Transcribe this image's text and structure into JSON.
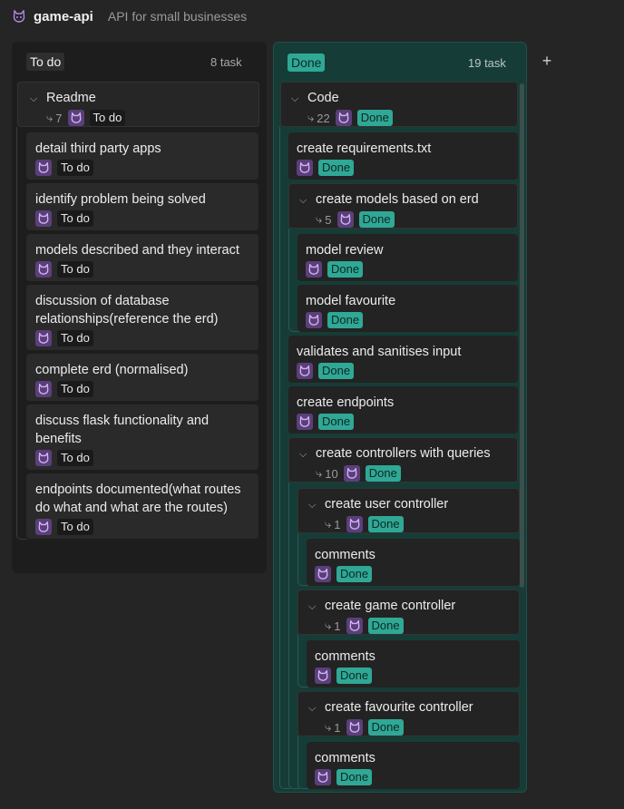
{
  "app": {
    "name": "game-api",
    "description": "API for small businesses"
  },
  "columns": {
    "todo": {
      "name": "To do",
      "count": "8 task"
    },
    "done": {
      "name": "Done",
      "count": "19 task"
    }
  },
  "add_column_label": "+",
  "colors": {
    "accent_done": "#2fa896",
    "avatar": "#5b3f7a",
    "background": "#252525"
  },
  "icons": {
    "app": "cat-icon",
    "avatar": "cat-icon",
    "subtasks": "branch-icon",
    "collapse": "chevron-down-icon"
  },
  "todo_cards": {
    "readme": {
      "title": "Readme",
      "subtasks": "7",
      "status": "To do"
    },
    "items": [
      {
        "title": "detail third party apps",
        "status": "To do"
      },
      {
        "title": "identify problem being solved",
        "status": "To do"
      },
      {
        "title": "models described and they interact",
        "status": "To do"
      },
      {
        "title": "discussion of database relationships(reference the erd)",
        "status": "To do"
      },
      {
        "title": "complete erd (normalised)",
        "status": "To do"
      },
      {
        "title": "discuss flask functionality and benefits",
        "status": "To do"
      },
      {
        "title": "endpoints documented(what routes do what and what are the routes)",
        "status": "To do"
      }
    ]
  },
  "done_cards": {
    "code": {
      "title": "Code",
      "subtasks": "22",
      "status": "Done"
    },
    "requirements": {
      "title": "create requirements.txt",
      "status": "Done"
    },
    "models": {
      "title": "create models based on erd",
      "subtasks": "5",
      "status": "Done"
    },
    "model_review": {
      "title": "model review",
      "status": "Done"
    },
    "model_favourite": {
      "title": "model favourite",
      "status": "Done"
    },
    "validates": {
      "title": "validates and sanitises input",
      "status": "Done"
    },
    "endpoints": {
      "title": "create endpoints",
      "status": "Done"
    },
    "controllers": {
      "title": "create controllers with queries",
      "subtasks": "10",
      "status": "Done"
    },
    "user_controller": {
      "title": "create user controller",
      "subtasks": "1",
      "status": "Done"
    },
    "user_comments": {
      "title": "comments",
      "status": "Done"
    },
    "game_controller": {
      "title": "create game controller",
      "subtasks": "1",
      "status": "Done"
    },
    "game_comments": {
      "title": "comments",
      "status": "Done"
    },
    "favourite_controller": {
      "title": "create favourite controller",
      "subtasks": "1",
      "status": "Done"
    },
    "favourite_comments": {
      "title": "comments",
      "status": "Done"
    }
  }
}
